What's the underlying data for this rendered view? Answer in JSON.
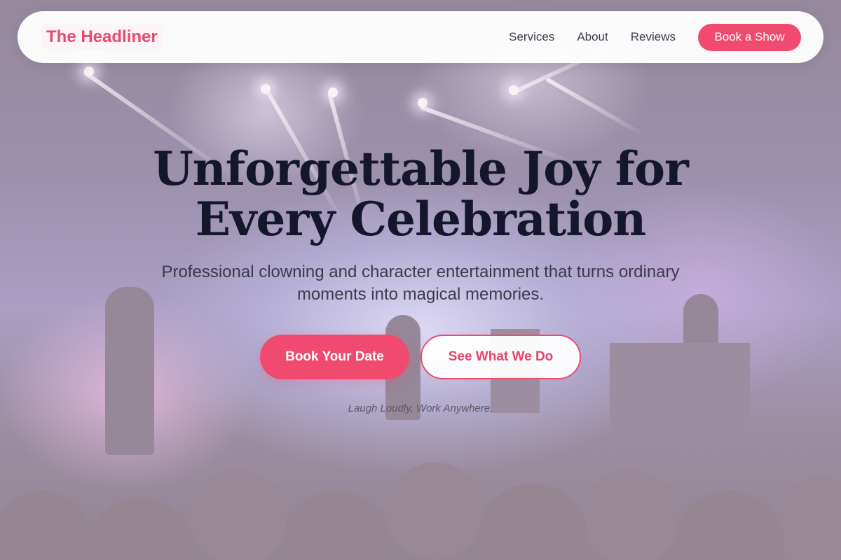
{
  "navbar": {
    "brand": "The Headliner",
    "links": [
      "Services",
      "About",
      "Reviews"
    ],
    "cta_label": "Book a Show"
  },
  "hero": {
    "headline_line1": "Unforgettable Joy for",
    "headline_line2": "Every Celebration",
    "subtitle": "Professional clowning and character entertainment that turns ordinary moments into magical memories.",
    "primary_button": "Book Your Date",
    "secondary_button": "See What We Do",
    "tagline": "Laugh Loudly, Work Anywhere.",
    "background_image": "concert-stage-crowd-photo"
  },
  "colors": {
    "accent": "#f04a6e",
    "brand_text": "#e84a6f",
    "headline": "#14162c",
    "overlay": "#fae4f0"
  }
}
